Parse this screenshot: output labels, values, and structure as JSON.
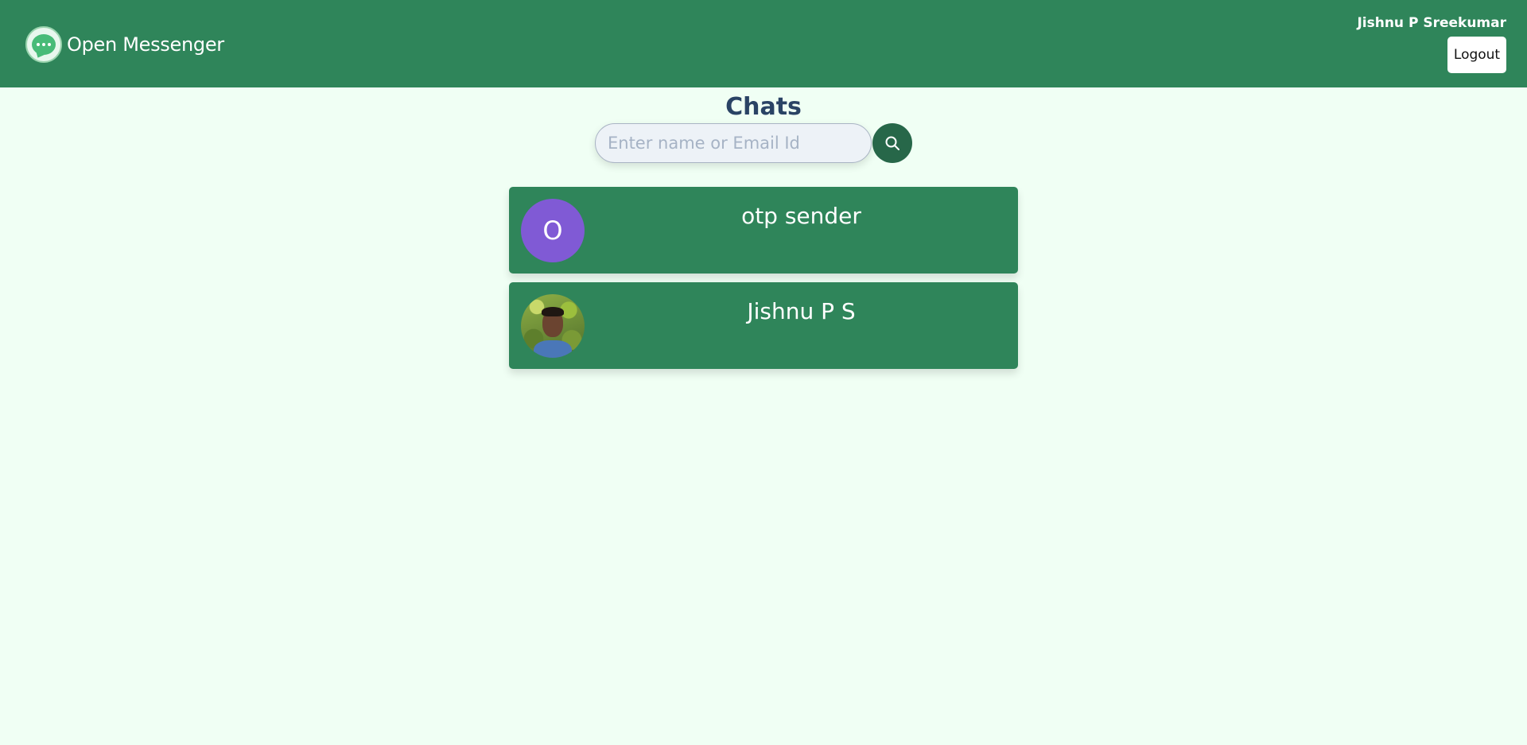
{
  "app": {
    "title": "Open Messenger",
    "logo_icon": "chat-bubble-icon"
  },
  "header": {
    "user_name": "Jishnu P Sreekumar",
    "logout_label": "Logout"
  },
  "main": {
    "title": "Chats",
    "search": {
      "placeholder": "Enter name or Email Id",
      "value": "",
      "button_icon": "search-icon"
    },
    "chats": [
      {
        "name": "otp sender",
        "avatar_type": "initial",
        "avatar_initial": "O",
        "avatar_color": "#805ad5"
      },
      {
        "name": "Jishnu P S",
        "avatar_type": "photo"
      }
    ]
  },
  "colors": {
    "navbar": "#2f855a",
    "page_background": "#f0fff4",
    "card": "#2f855a",
    "search_button": "#276749",
    "title_text": "#2a4365"
  }
}
